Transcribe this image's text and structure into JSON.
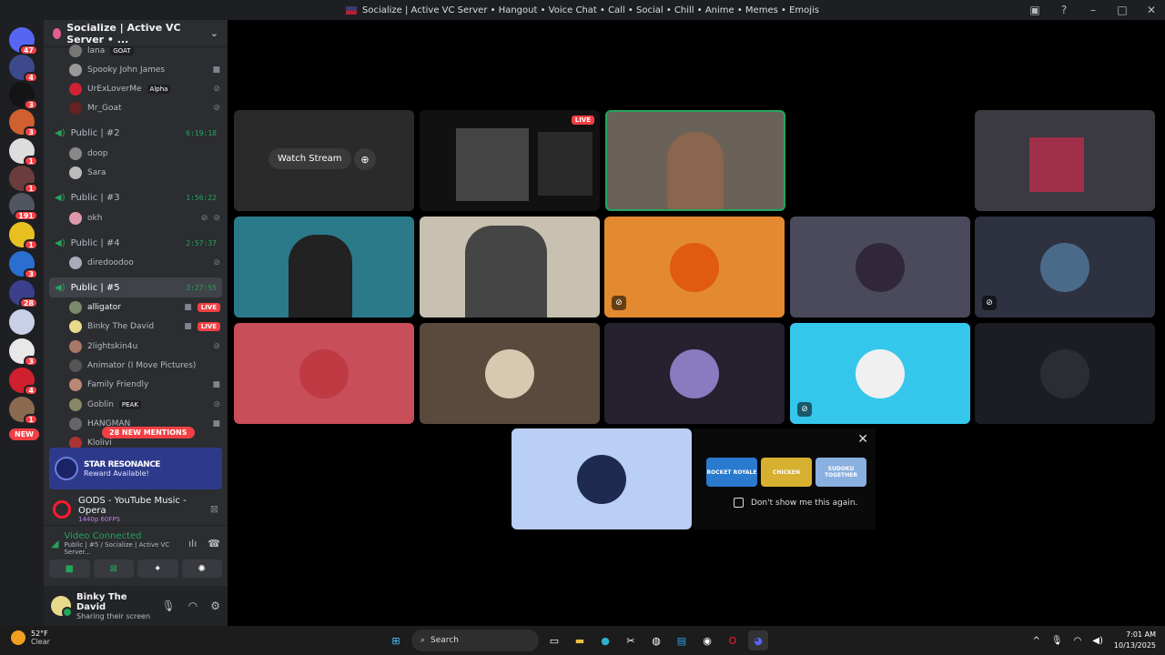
{
  "window": {
    "title": "Socialize | Active VC Server • Hangout • Voice Chat • Call • Social • Chill • Anime • Memes • Emojis"
  },
  "rail": {
    "badges": [
      "47",
      "4",
      "3",
      "3",
      "1",
      "1",
      "191",
      "1",
      "3",
      "28",
      "3",
      "4",
      "1"
    ],
    "new_label": "NEW"
  },
  "sidebar": {
    "server_name": "Socialize | Active VC Server • ...",
    "top_users": [
      {
        "name": "lana",
        "tag": "GOAT"
      },
      {
        "name": "Spooky John James",
        "tag": ""
      },
      {
        "name": "UrExLoverMe",
        "tag": "Alpha"
      },
      {
        "name": "Mr_Goat",
        "tag": ""
      }
    ],
    "channels": [
      {
        "name": "Public | #2",
        "timer": "6:19:18",
        "users": [
          "doop",
          "Sara"
        ]
      },
      {
        "name": "Public | #3",
        "timer": "1:56:22",
        "users": [
          "okh"
        ]
      },
      {
        "name": "Public | #4",
        "timer": "2:57:37",
        "users": [
          "diredoodoo"
        ]
      },
      {
        "name": "Public | #5",
        "timer": "3:27:55",
        "users": [
          "alligator",
          "Binky The David",
          "2lightskin4u",
          "Animator (I Move Pictures)",
          "Family Friendly",
          "Goblin",
          "HANGMAN",
          "Klolivi"
        ]
      }
    ],
    "live_label": "LIVE",
    "peak_tag": "PEAK",
    "mentions": "28 NEW MENTIONS",
    "promo": {
      "title": "STAR RESONANCE",
      "subtitle": "Reward Available!"
    },
    "activity": {
      "title": "GODS - YouTube Music - Opera",
      "sub": "1440p 60FPS"
    },
    "voice": {
      "status": "Video Connected",
      "location": "Public | #5 / Socialize | Active VC Server..."
    },
    "user": {
      "name": "Binky The David",
      "status": "Sharing their screen"
    }
  },
  "stage": {
    "watch_stream": "Watch Stream",
    "live_label": "LIVE",
    "dont_show": "Don't show me this again.",
    "games": [
      "ROCKET ROYALE",
      "CHICKEN",
      "SUDOKU TOGETHER"
    ]
  },
  "taskbar": {
    "temp": "52°F",
    "condition": "Clear",
    "search": "Search",
    "time": "7:01 AM",
    "date": "10/13/2025"
  },
  "colors": {
    "accent_green": "#23a55a",
    "live_red": "#f23f43",
    "sidebar_bg": "#2b2d31"
  }
}
